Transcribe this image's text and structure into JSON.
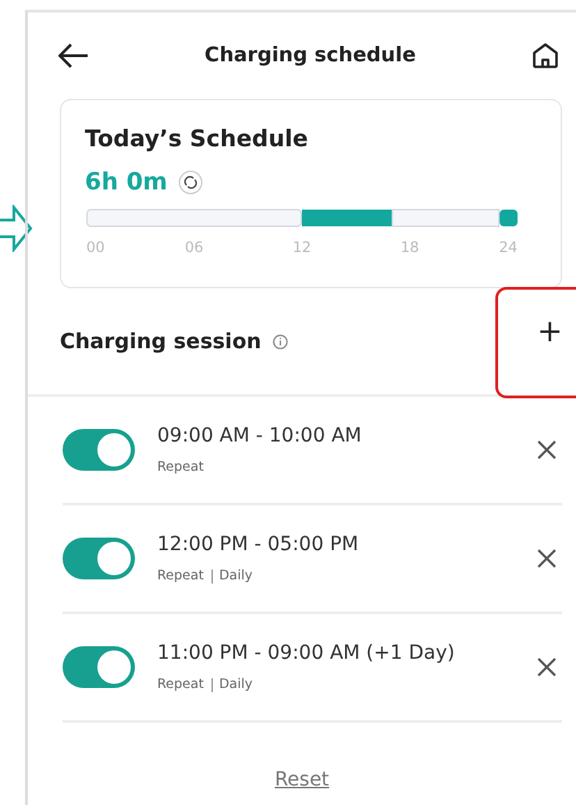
{
  "header": {
    "title": "Charging schedule"
  },
  "today": {
    "title": "Today’s Schedule",
    "duration": "6h 0m",
    "chart_data": {
      "type": "bar",
      "orientation": "horizontal",
      "stacked": true,
      "xlim": [
        0,
        24
      ],
      "xticks": [
        {
          "value": 0,
          "label": "00"
        },
        {
          "value": 6,
          "label": "06"
        },
        {
          "value": 12,
          "label": "12"
        },
        {
          "value": 18,
          "label": "18"
        },
        {
          "value": 24,
          "label": "24"
        }
      ],
      "series": [
        {
          "color": "#f4f6f9",
          "values": [
            12
          ]
        },
        {
          "color": "#13a89e",
          "values": [
            5
          ]
        },
        {
          "color": "#f4f6f9",
          "values": [
            6
          ]
        },
        {
          "color": "#13a89e",
          "values": [
            1
          ]
        }
      ]
    }
  },
  "sessions_header": {
    "title": "Charging session",
    "add": "+"
  },
  "sessions": [
    {
      "time": "09:00 AM - 10:00 AM",
      "repeat": "Repeat",
      "on": true
    },
    {
      "time": "12:00 PM - 05:00 PM",
      "repeat": "Repeat",
      "days": "Daily",
      "on": true
    },
    {
      "time": "11:00 PM - 09:00 AM (+1 Day)",
      "repeat": "Repeat",
      "days": "Daily",
      "on": true
    }
  ],
  "reset": "Reset"
}
